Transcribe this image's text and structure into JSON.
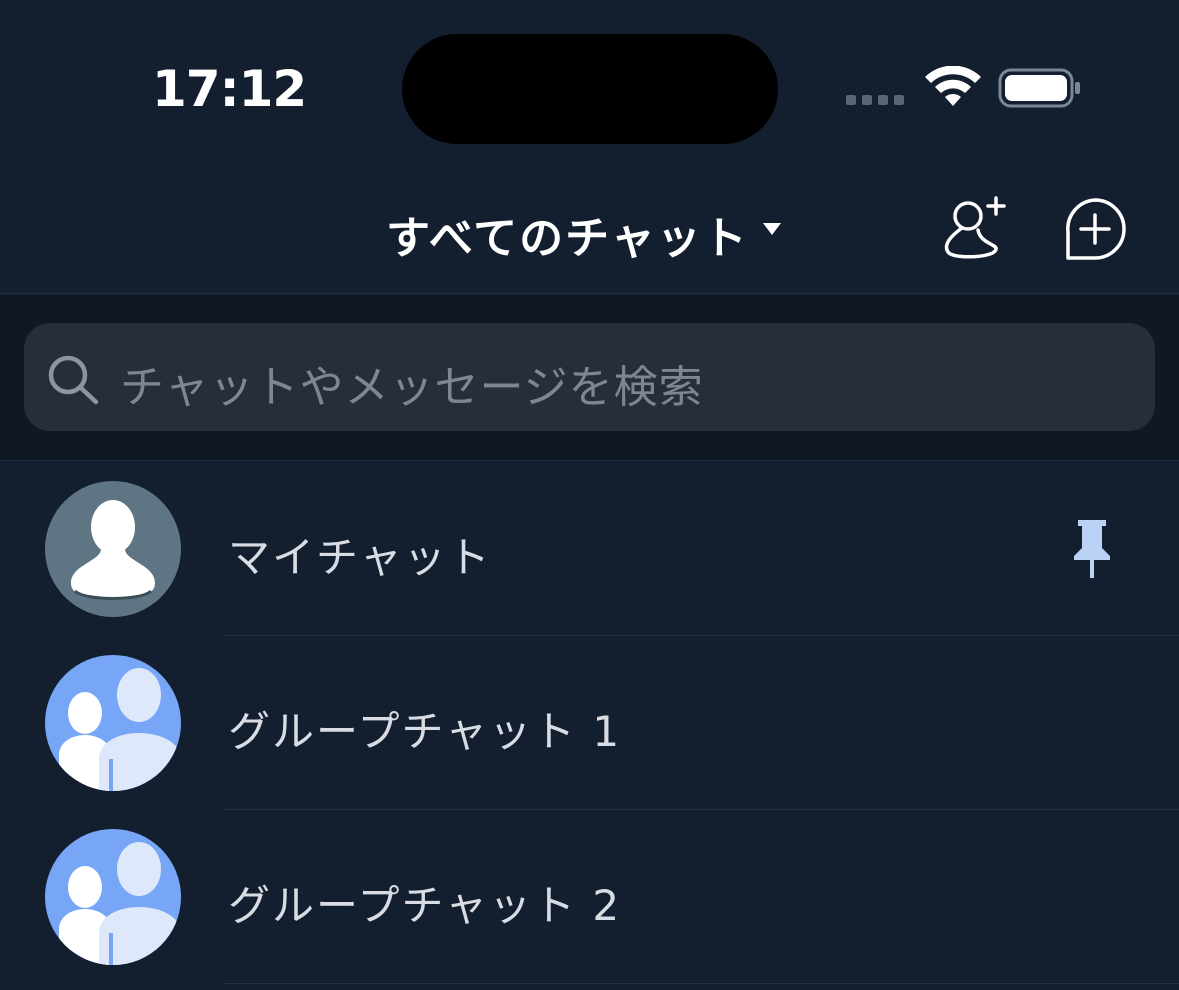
{
  "status_bar": {
    "time": "17:12"
  },
  "header": {
    "title": "すべてのチャット",
    "add_friend_icon": "add-friend-icon",
    "new_chat_icon": "new-chat-icon"
  },
  "search": {
    "placeholder": "チャットやメッセージを検索"
  },
  "chats": [
    {
      "name": "マイチャット",
      "avatar": "single-user-avatar",
      "pinned": true
    },
    {
      "name": "グループチャット 1",
      "avatar": "group-avatar",
      "pinned": false
    },
    {
      "name": "グループチャット 2",
      "avatar": "group-avatar",
      "pinned": false
    }
  ],
  "colors": {
    "background": "#131f2f",
    "search_field": "#262e3a",
    "group_avatar_bg": "#78a6f6",
    "single_avatar_bg": "#5f7584",
    "pin": "#b9d2f5"
  }
}
